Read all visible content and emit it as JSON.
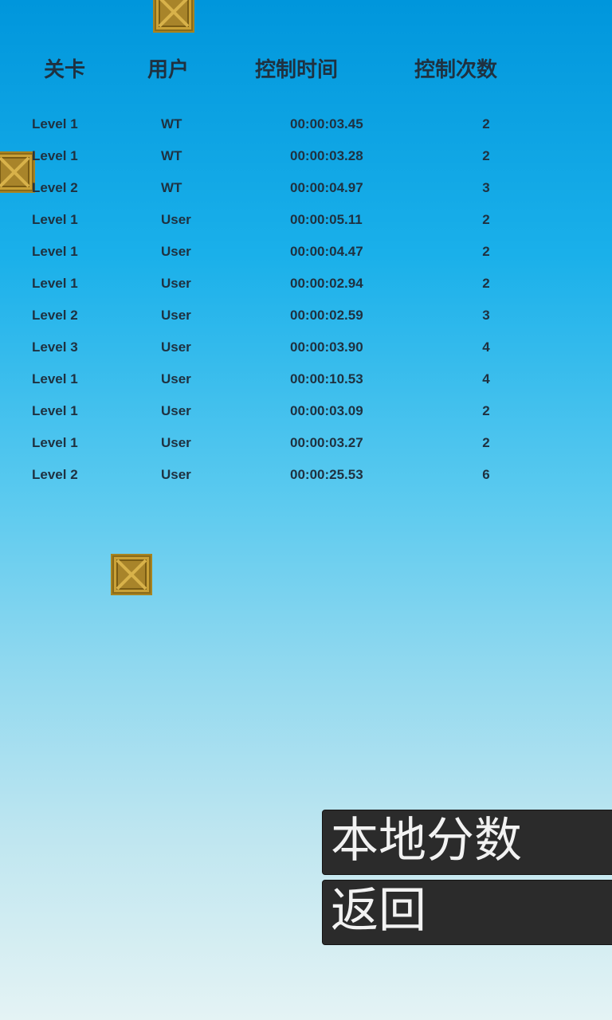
{
  "header": {
    "level": "关卡",
    "user": "用户",
    "time": "控制时间",
    "count": "控制次数"
  },
  "scores": [
    {
      "level": "Level 1",
      "user": "WT",
      "time": "00:00:03.45",
      "count": "2"
    },
    {
      "level": "Level 1",
      "user": "WT",
      "time": "00:00:03.28",
      "count": "2"
    },
    {
      "level": "Level 2",
      "user": "WT",
      "time": "00:00:04.97",
      "count": "3"
    },
    {
      "level": "Level 1",
      "user": "User",
      "time": "00:00:05.11",
      "count": "2"
    },
    {
      "level": "Level 1",
      "user": "User",
      "time": "00:00:04.47",
      "count": "2"
    },
    {
      "level": "Level 1",
      "user": "User",
      "time": "00:00:02.94",
      "count": "2"
    },
    {
      "level": "Level 2",
      "user": "User",
      "time": "00:00:02.59",
      "count": "3"
    },
    {
      "level": "Level 3",
      "user": "User",
      "time": "00:00:03.90",
      "count": "4"
    },
    {
      "level": "Level 1",
      "user": "User",
      "time": "00:00:10.53",
      "count": "4"
    },
    {
      "level": "Level 1",
      "user": "User",
      "time": "00:00:03.09",
      "count": "2"
    },
    {
      "level": "Level 1",
      "user": "User",
      "time": "00:00:03.27",
      "count": "2"
    },
    {
      "level": "Level 2",
      "user": "User",
      "time": "00:00:25.53",
      "count": "6"
    }
  ],
  "buttons": {
    "local_scores": "本地分数",
    "back": "返回"
  },
  "crate_icon": "wooden-crate-icon",
  "colors": {
    "text": "#1f3140",
    "button_bg": "#2b2b2b",
    "button_text": "#f2f2f2",
    "crate": "#c9a137"
  }
}
